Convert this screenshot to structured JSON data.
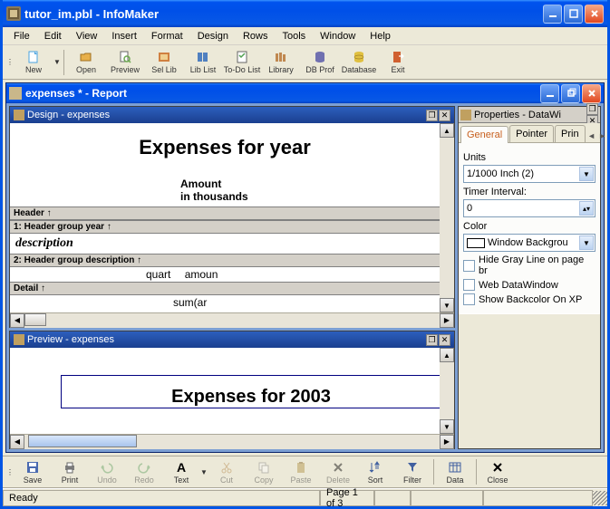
{
  "window": {
    "title": "tutor_im.pbl - InfoMaker"
  },
  "menu": {
    "file": "File",
    "edit": "Edit",
    "view": "View",
    "insert": "Insert",
    "format": "Format",
    "design": "Design",
    "rows": "Rows",
    "tools": "Tools",
    "window": "Window",
    "help": "Help"
  },
  "toolbar_top": [
    {
      "id": "new",
      "label": "New"
    },
    {
      "id": "open",
      "label": "Open"
    },
    {
      "id": "preview",
      "label": "Preview"
    },
    {
      "id": "sel-lib",
      "label": "Sel Lib"
    },
    {
      "id": "lib-list",
      "label": "Lib List"
    },
    {
      "id": "todo-list",
      "label": "To-Do List"
    },
    {
      "id": "library",
      "label": "Library"
    },
    {
      "id": "db-prof",
      "label": "DB Prof"
    },
    {
      "id": "database",
      "label": "Database"
    },
    {
      "id": "exit",
      "label": "Exit"
    }
  ],
  "report_window": {
    "title": "expenses * - Report"
  },
  "design_panel": {
    "title": "Design - expenses",
    "report_title": "Expenses for  year",
    "amount_hdr_1": "Amount",
    "amount_hdr_2": "in thousands",
    "band_header": "Header ↑",
    "band_group_year": "1: Header group year ↑",
    "description_label": "description",
    "band_group_desc": "2: Header group description ↑",
    "detail_quarter": "quart",
    "detail_amount": "amoun",
    "band_detail": "Detail ↑",
    "sum_label": "sum(ar"
  },
  "preview_panel": {
    "title": "Preview - expenses",
    "report_title": "Expenses for  2003"
  },
  "properties": {
    "title": "Properties - DataWi",
    "tabs": {
      "general": "General",
      "pointer": "Pointer",
      "print": "Prin"
    },
    "units_label": "Units",
    "units_value": "1/1000 Inch (2)",
    "timer_label": "Timer Interval:",
    "timer_value": "0",
    "color_label": "Color",
    "color_value": "Window Backgrou",
    "check_gray": "Hide Gray Line on page br",
    "check_web": "Web DataWindow",
    "check_xp": "Show Backcolor On XP"
  },
  "toolbar_bottom": [
    {
      "id": "save",
      "label": "Save",
      "disabled": false
    },
    {
      "id": "print",
      "label": "Print",
      "disabled": false
    },
    {
      "id": "undo",
      "label": "Undo",
      "disabled": true
    },
    {
      "id": "redo",
      "label": "Redo",
      "disabled": true
    },
    {
      "id": "text",
      "label": "Text",
      "disabled": false
    },
    {
      "id": "cut",
      "label": "Cut",
      "disabled": true
    },
    {
      "id": "copy",
      "label": "Copy",
      "disabled": true
    },
    {
      "id": "paste",
      "label": "Paste",
      "disabled": true
    },
    {
      "id": "delete",
      "label": "Delete",
      "disabled": true
    },
    {
      "id": "sort",
      "label": "Sort",
      "disabled": false
    },
    {
      "id": "filter",
      "label": "Filter",
      "disabled": false
    },
    {
      "id": "data",
      "label": "Data",
      "disabled": false
    },
    {
      "id": "close",
      "label": "Close",
      "disabled": false
    }
  ],
  "status": {
    "ready": "Ready",
    "page": "Page 1 of 3"
  },
  "icons": {
    "new": "#4aa3df",
    "open": "#e8b04a",
    "preview": "#6aa84f",
    "sel-lib": "#d08040",
    "lib-list": "#5080c0",
    "todo-list": "#50a050",
    "library": "#c08850",
    "db-prof": "#7070b0",
    "database": "#e0c040",
    "exit": "#d06030",
    "save": "#4a6ab0",
    "print": "#808080",
    "undo": "#60a060",
    "redo": "#60a060",
    "text": "#000000",
    "cut": "#b08040",
    "copy": "#808080",
    "paste": "#b09040",
    "delete": "#000000",
    "sort": "#4060a0",
    "filter": "#4060a0",
    "data": "#4060a0",
    "close": "#000000"
  }
}
